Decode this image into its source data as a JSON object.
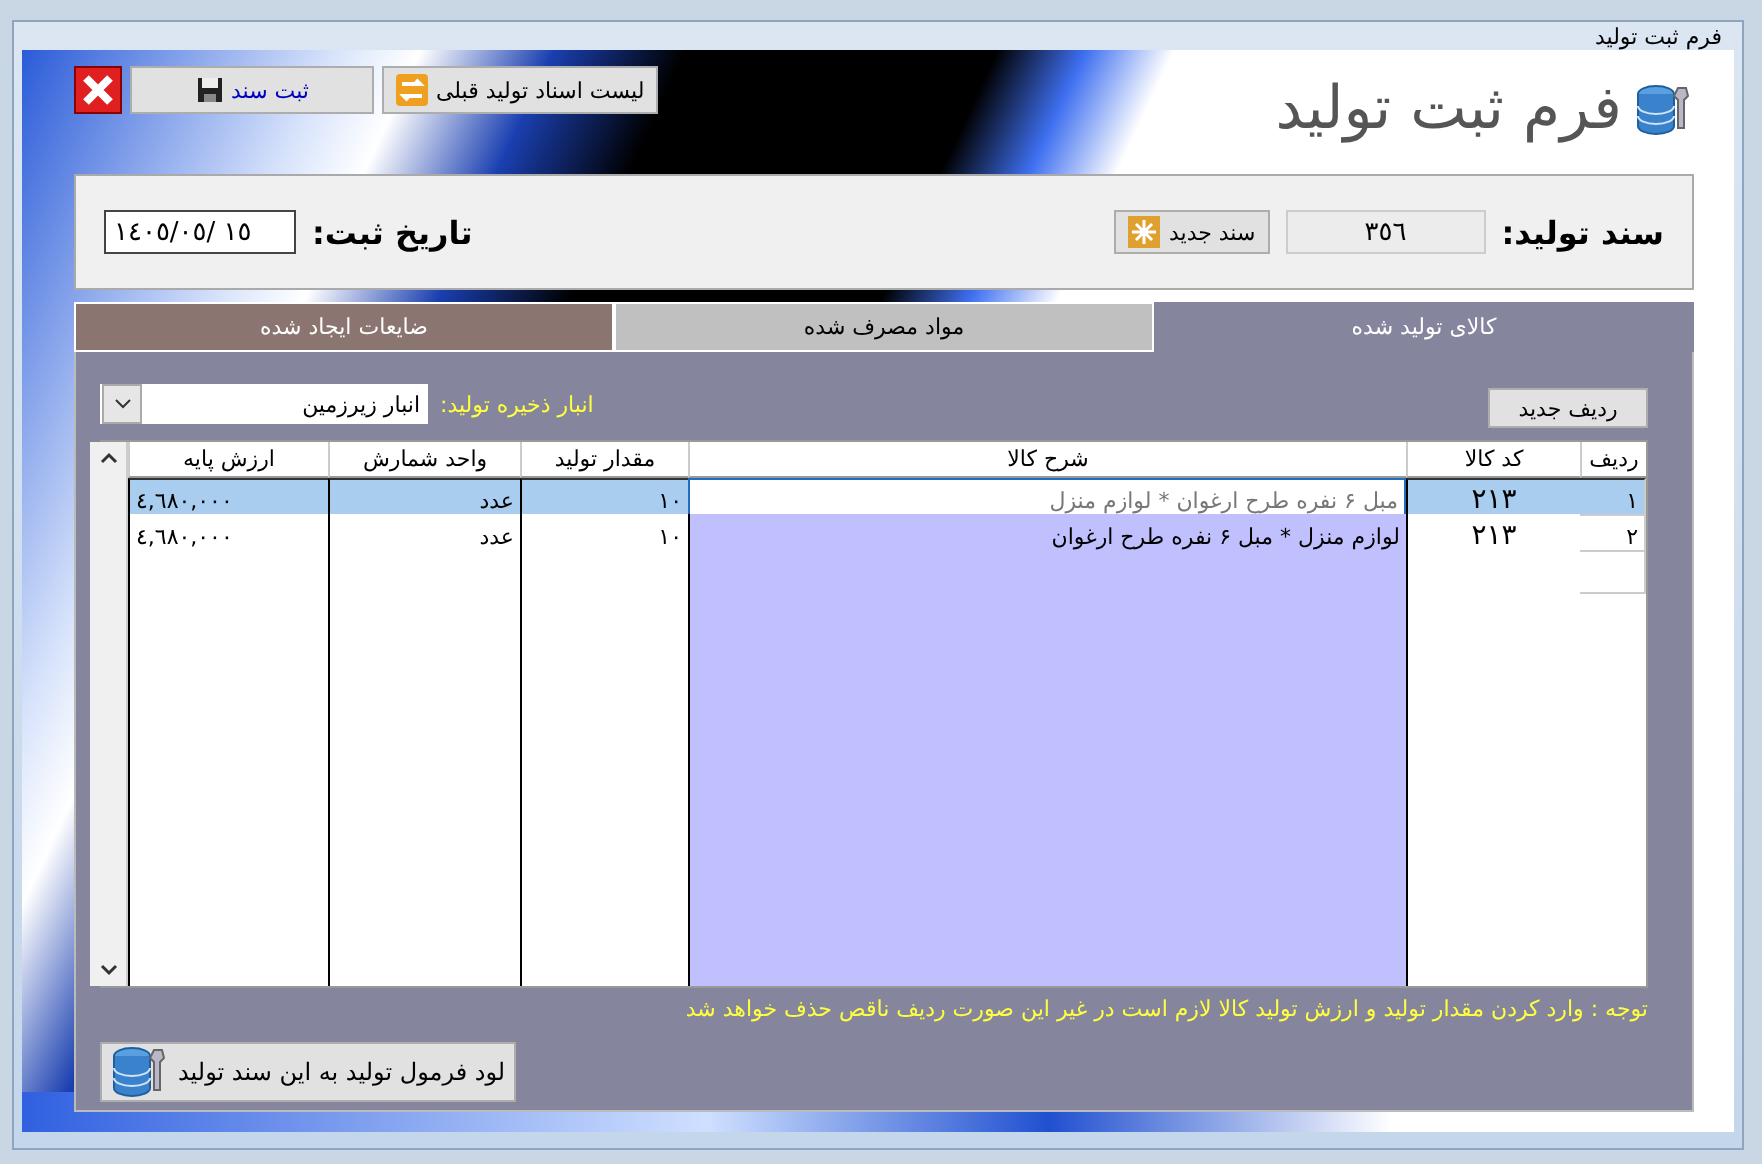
{
  "window": {
    "title": "فرم ثبت تولید"
  },
  "header": {
    "title": "فرم ثبت تولید",
    "buttons": [
      {
        "kind": "list",
        "label": "لیست اسناد تولید قبلی"
      },
      {
        "kind": "save",
        "label": "ثبت سند"
      },
      {
        "kind": "close"
      }
    ]
  },
  "doc": {
    "label": "سند تولید:",
    "number": "٣٥٦",
    "new_button": "سند جدید",
    "date_label": "تاریخ ثبت:",
    "date": "١٤٠٥/٠٥/ ١٥"
  },
  "tabs": [
    {
      "label": "کالای تولید شده",
      "selected": true,
      "color": "#85869e"
    },
    {
      "label": "مواد مصرف شده",
      "selected": false,
      "color": "#c0c0c0"
    },
    {
      "label": "ضایعات ایجاد شده",
      "selected": false,
      "color": "#8a7570"
    }
  ],
  "new_row_button": "ردیف جدید",
  "warehouse": {
    "label": "انبار ذخیره تولید:",
    "value": "انبار زیرزمین"
  },
  "table": {
    "columns": [
      "ردیف",
      "کد کالا",
      "شرح کالا",
      "مقدار تولید",
      "واحد شمارش",
      "ارزش پایه"
    ],
    "rows": [
      {
        "selected": true,
        "cells": [
          "١",
          "٢١٣",
          "مبل ۶ نفره طرح ارغوان  *  لوازم منزل",
          "١٠",
          "عدد",
          "٤,٦٨٠,٠٠٠"
        ]
      },
      {
        "selected": false,
        "cells": [
          "٢",
          "٢١٣",
          "لوازم منزل *  مبل ۶ نفره طرح ارغوان",
          "١٠",
          "عدد",
          "٤,٦٨٠,٠٠٠"
        ]
      }
    ]
  },
  "note": "توجه : وارد کردن مقدار تولید و ارزش تولید کالا لازم است در غیر این صورت ردیف ناقص حذف خواهد شد",
  "load_button": "لود فرمول تولید به این سند تولید"
}
